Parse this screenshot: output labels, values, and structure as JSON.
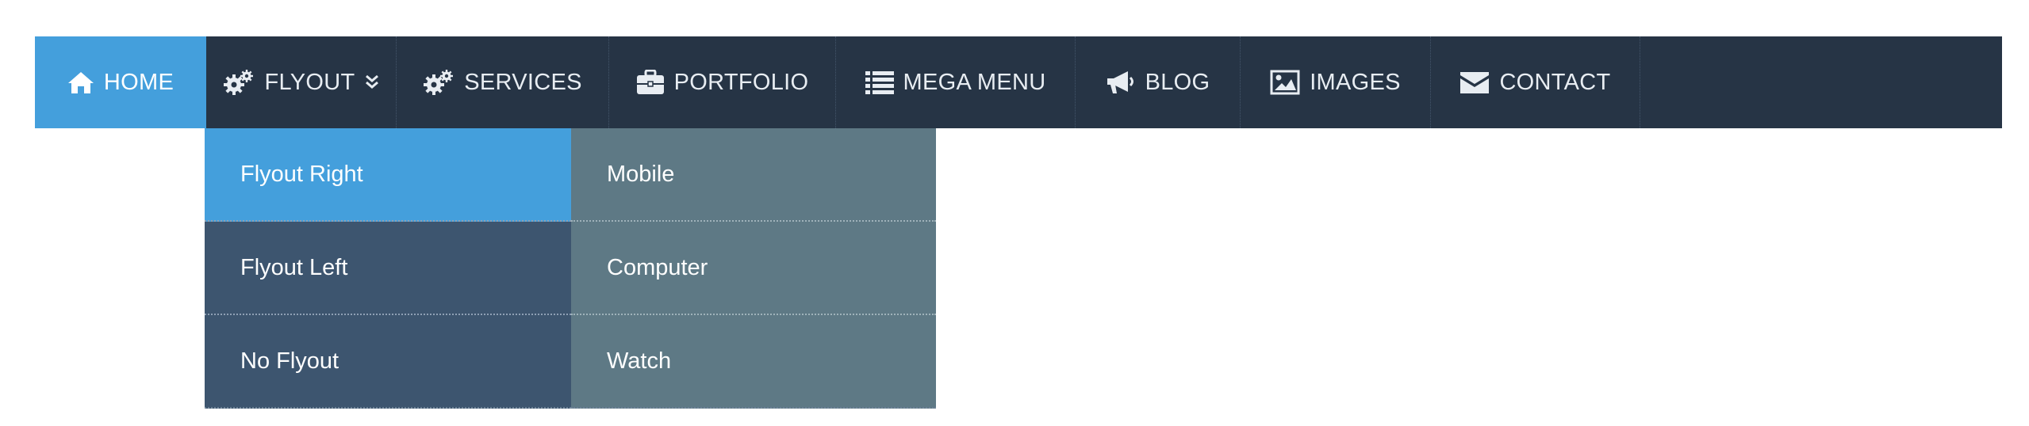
{
  "nav": {
    "items": [
      {
        "label": "HOME",
        "icon": "home-icon",
        "active": true
      },
      {
        "label": "FLYOUT",
        "icon": "gears-icon",
        "caret": "chevron-double-down-icon"
      },
      {
        "label": "SERVICES",
        "icon": "gears-icon"
      },
      {
        "label": "PORTFOLIO",
        "icon": "briefcase-icon"
      },
      {
        "label": "MEGA MENU",
        "icon": "list-icon"
      },
      {
        "label": "BLOG",
        "icon": "megaphone-icon"
      },
      {
        "label": "IMAGES",
        "icon": "image-icon"
      },
      {
        "label": "CONTACT",
        "icon": "envelope-icon"
      }
    ]
  },
  "flyout": {
    "items": [
      {
        "label": "Flyout Right",
        "active": true
      },
      {
        "label": "Flyout Left"
      },
      {
        "label": "No Flyout"
      }
    ],
    "submenu": {
      "items": [
        {
          "label": "Mobile"
        },
        {
          "label": "Computer"
        },
        {
          "label": "Watch"
        }
      ]
    }
  },
  "colors": {
    "navbar": "#263445",
    "accent": "#449fdc",
    "dropdown": "#3d556f",
    "submenu": "#5e7985",
    "text": "#ffffff"
  }
}
